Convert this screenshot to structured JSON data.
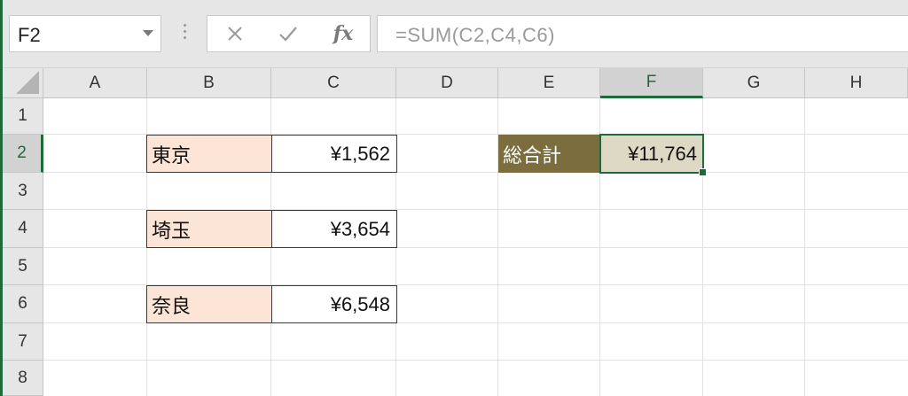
{
  "name_box": {
    "value": "F2"
  },
  "formula_bar": {
    "formula": "=SUM(C2,C4,C6)",
    "cancel_icon": "✕",
    "enter_icon": "✓",
    "fx_label": "fx"
  },
  "columns": [
    "A",
    "B",
    "C",
    "D",
    "E",
    "F",
    "G",
    "H"
  ],
  "rows": [
    "1",
    "2",
    "3",
    "4",
    "5",
    "6",
    "7",
    "8"
  ],
  "active_cell": {
    "column": "F",
    "row": "2"
  },
  "cells": {
    "B2": "東京",
    "C2": "¥1,562",
    "B4": "埼玉",
    "C4": "¥3,654",
    "B6": "奈良",
    "C6": "¥6,548",
    "E2": "総合計",
    "F2": "¥11,764"
  },
  "colors": {
    "accent": "#1e6b3a",
    "label_fill": "#fce4d6",
    "total_label_fill": "#7b6d3e",
    "total_value_fill": "#ddd9c4"
  }
}
